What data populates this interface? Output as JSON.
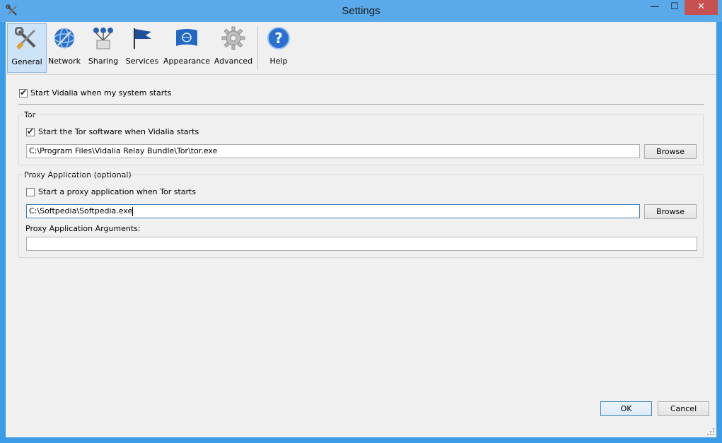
{
  "window": {
    "title": "Settings",
    "minimize": "—",
    "maximize": "☐",
    "close": "✕"
  },
  "toolbar": {
    "items": [
      {
        "label": "General",
        "icon": "tools-icon"
      },
      {
        "label": "Network",
        "icon": "network-globe-icon"
      },
      {
        "label": "Sharing",
        "icon": "sharing-icon"
      },
      {
        "label": "Services",
        "icon": "services-flag-icon"
      },
      {
        "label": "Appearance",
        "icon": "appearance-flag-icon"
      },
      {
        "label": "Advanced",
        "icon": "gear-icon"
      },
      {
        "label": "Help",
        "icon": "help-icon"
      }
    ],
    "active": "General"
  },
  "general": {
    "start_vidalia_label": "Start Vidalia when my system starts",
    "start_vidalia_checked": true
  },
  "tor": {
    "group_title": "Tor",
    "start_tor_label": "Start the Tor software when Vidalia starts",
    "start_tor_checked": true,
    "path_value": "C:\\Program Files\\Vidalia Relay Bundle\\Tor\\tor.exe",
    "browse_label": "Browse"
  },
  "proxy": {
    "group_title": "Proxy Application (optional)",
    "start_proxy_label": "Start a proxy application when Tor starts",
    "start_proxy_checked": false,
    "path_value": "C:\\Softpedia\\Softpedia.exe",
    "browse_label": "Browse",
    "args_label": "Proxy Application Arguments:",
    "args_value": ""
  },
  "footer": {
    "ok_label": "OK",
    "cancel_label": "Cancel"
  }
}
